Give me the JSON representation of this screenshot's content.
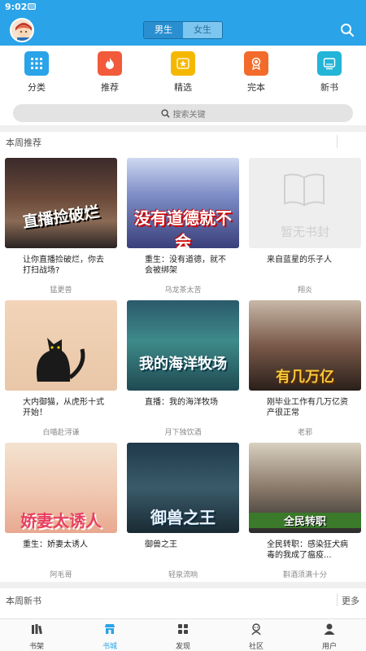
{
  "status": {
    "time": "9:02"
  },
  "header": {
    "tabs": [
      {
        "label": "男生",
        "active": true
      },
      {
        "label": "女生",
        "active": false
      }
    ],
    "accent": "#2aa3e8"
  },
  "categories": [
    {
      "label": "分类",
      "icon": "grid-icon",
      "color": "#2aa3e8"
    },
    {
      "label": "推荐",
      "icon": "flame-icon",
      "color": "#f15a3a"
    },
    {
      "label": "精选",
      "icon": "star-icon",
      "color": "#f5b800"
    },
    {
      "label": "完本",
      "icon": "medal-icon",
      "color": "#f26b2a"
    },
    {
      "label": "新书",
      "icon": "monitor-icon",
      "color": "#22b5d8"
    }
  ],
  "search": {
    "placeholder": "搜索关键"
  },
  "weekly_recommend": {
    "title": "本周推荐",
    "books": [
      {
        "title": "让你直播捡破烂，你去打扫战场?",
        "author": "猛更兽",
        "cover_text": "直播捡破烂"
      },
      {
        "title": "重生：没有道德，就不会被绑架",
        "author": "乌龙茶太苦",
        "cover_text": "没有道德就不会"
      },
      {
        "title": "来自蓝星的乐子人",
        "author": "翔炎",
        "cover_text": "暂无书封"
      },
      {
        "title": "大内御猫，从虎形十式开始！",
        "author": "白喵赴浔谦",
        "cover_text": ""
      },
      {
        "title": "直播：我的海洋牧场",
        "author": "月下独饮酒",
        "cover_text": "我的海洋牧场"
      },
      {
        "title": "刚毕业工作有几万亿资产很正常",
        "author": "老邪",
        "cover_text": "有几万亿"
      },
      {
        "title": "重生：娇妻太诱人",
        "author": "阿毛哥",
        "cover_text": "娇妻太诱人"
      },
      {
        "title": "御兽之王",
        "author": "轻泉流响",
        "cover_text": "御兽之王"
      },
      {
        "title": "全民转职：感染狂犬病毒的我成了瘟疫...",
        "author": "斟酒须满十分",
        "cover_text": "全民转职"
      }
    ]
  },
  "new_books": {
    "title": "本周新书",
    "more": "更多"
  },
  "tabbar": [
    {
      "label": "书架",
      "icon": "bookshelf-icon",
      "active": false
    },
    {
      "label": "书城",
      "icon": "store-icon",
      "active": true
    },
    {
      "label": "发现",
      "icon": "discover-icon",
      "active": false
    },
    {
      "label": "社区",
      "icon": "community-icon",
      "active": false
    },
    {
      "label": "用户",
      "icon": "user-icon",
      "active": false
    }
  ]
}
